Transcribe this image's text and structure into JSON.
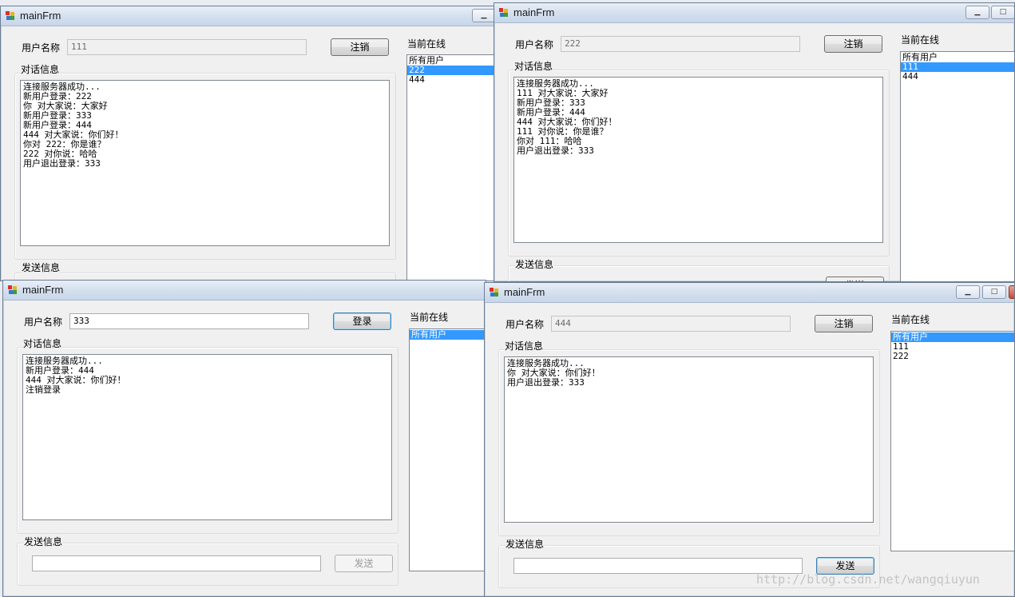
{
  "windows": [
    {
      "title": "mainFrm",
      "username_label": "用户名称",
      "username_value": "111",
      "auth_button": "注销",
      "conversation_label": "对话信息",
      "messages": [
        "连接服务器成功...",
        "新用户登录：222",
        "你 对大家说：大家好",
        "新用户登录：333",
        "新用户登录：444",
        "444 对大家说：你们好！",
        "你对 222：你是谁？",
        "222 对你说：哈哈",
        "用户退出登录：333"
      ],
      "send_label": "发送信息",
      "online_label": "当前在线",
      "online_users": [
        "所有用户",
        "222",
        "444"
      ],
      "selected_user": "222"
    },
    {
      "title": "mainFrm",
      "username_label": "用户名称",
      "username_value": "222",
      "auth_button": "注销",
      "conversation_label": "对话信息",
      "messages": [
        "连接服务器成功...",
        "111 对大家说：大家好",
        "新用户登录：333",
        "新用户登录：444",
        "444 对大家说：你们好！",
        "111 对你说：你是谁？",
        "你对 111：哈哈",
        "用户退出登录：333"
      ],
      "send_label": "发送信息",
      "send_button": "发送",
      "online_label": "当前在线",
      "online_users": [
        "所有用户",
        "111",
        "444"
      ],
      "selected_user": "111"
    },
    {
      "title": "mainFrm",
      "username_label": "用户名称",
      "username_value": "333",
      "auth_button": "登录",
      "conversation_label": "对话信息",
      "messages": [
        "连接服务器成功...",
        "新用户登录：444",
        "444 对大家说：你们好！",
        "注销登录"
      ],
      "send_label": "发送信息",
      "message_input": "",
      "send_button": "发送",
      "online_label": "当前在线",
      "online_users": [
        "所有用户"
      ],
      "selected_user": "所有用户"
    },
    {
      "title": "mainFrm",
      "username_label": "用户名称",
      "username_value": "444",
      "auth_button": "注销",
      "conversation_label": "对话信息",
      "messages": [
        "连接服务器成功...",
        "你 对大家说：你们好！",
        "用户退出登录：333"
      ],
      "send_label": "发送信息",
      "message_input": "",
      "send_button": "发送",
      "online_label": "当前在线",
      "online_users": [
        "所有用户",
        "111",
        "222"
      ],
      "selected_user": "所有用户"
    }
  ],
  "watermark": "http://blog.csdn.net/wangqiuyun",
  "colors": {
    "selection": "#3399ff",
    "focus_border": "#3c7fb1"
  },
  "icons": {
    "minimize": "minimize-icon",
    "maximize": "maximize-icon",
    "close": "close-icon"
  }
}
